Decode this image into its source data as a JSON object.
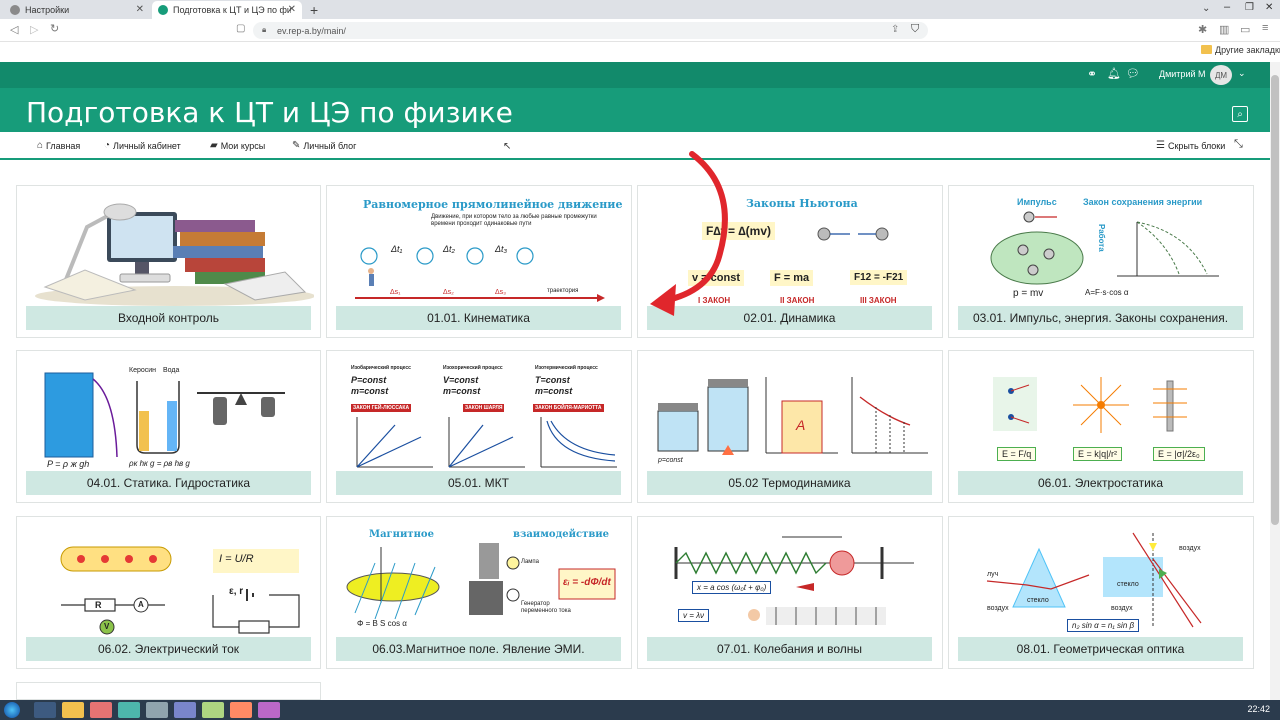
{
  "browser": {
    "tabs": [
      {
        "title": "Настройки",
        "active": false
      },
      {
        "title": "Подготовка к ЦТ и ЦЭ по физике",
        "active": true
      },
      {
        "title": "",
        "active": false
      }
    ],
    "new_tab_label": "+",
    "url": "ev.rep-a.by/main/",
    "bookmarks_folder": "Другие закладки"
  },
  "site": {
    "user_name": "Дмитрий М",
    "user_initials": "ДМ",
    "title": "Подготовка к ЦТ и ЦЭ по физике",
    "nav": [
      {
        "label": "Главная",
        "icon": "home-icon"
      },
      {
        "label": "Личный кабинет",
        "icon": "dashboard-icon"
      },
      {
        "label": "Мои курсы",
        "icon": "briefcase-icon"
      },
      {
        "label": "Личный блог",
        "icon": "wrench-icon"
      }
    ],
    "hide_blocks_label": "Скрыть блоки"
  },
  "courses": [
    {
      "label": "Входной контроль",
      "image": "desk"
    },
    {
      "label": "01.01. Кинематика",
      "image": "kinematics",
      "heading": "Равномерное прямолинейное движение",
      "text": "Движение, при котором тело за любые равные промежутки времени проходит одинаковые пути",
      "path_label": "траектория"
    },
    {
      "label": "02.01. Динамика",
      "image": "dynamics",
      "heading": "Законы Ньютона",
      "laws": [
        "I ЗАКОН",
        "II ЗАКОН",
        "III ЗАКОН"
      ],
      "formulas": [
        "F∆t = ∆(mv)",
        "v = const",
        "F = ma",
        "F12 = -F21"
      ]
    },
    {
      "label": "03.01. Импульс, энергия. Законы сохранения.",
      "image": "momentum",
      "heading_left": "Импульс",
      "heading_right": "Закон сохранения энергии",
      "side_label": "Работа",
      "formulas": [
        "p = mv",
        "A=F·s·cos α"
      ]
    },
    {
      "label": "04.01. Статика. Гидростатика",
      "image": "statics",
      "liquids": [
        "Керосин",
        "Вода"
      ],
      "formulas": [
        "P = ρ ж gh",
        "ρк hк g = ρв hв g"
      ]
    },
    {
      "label": "05.01. МКТ",
      "image": "mkt",
      "processes": [
        {
          "name": "Изобарический процесс",
          "lines": [
            "P=const",
            "m=const"
          ],
          "law": "ЗАКОН ГЕЙ-ЛЮССАКА"
        },
        {
          "name": "Изохорический процесс",
          "lines": [
            "V=const",
            "m=const"
          ],
          "law": "ЗАКОН ШАРЛЯ"
        },
        {
          "name": "Изотермический процесс",
          "lines": [
            "T=const",
            "m=const"
          ],
          "law": "ЗАКОН БОЙЛЯ-МАРИОТТА"
        }
      ]
    },
    {
      "label": "05.02 Термодинамика",
      "image": "thermo",
      "formulas": [
        "p=const",
        "A"
      ]
    },
    {
      "label": "06.01. Электростатика",
      "image": "electrostatics",
      "formulas": [
        "E = F/q",
        "E = k|q|/r²",
        "E = |σ|/2ε₀"
      ]
    },
    {
      "label": "06.02. Электрический ток",
      "image": "current",
      "formulas": [
        "I = U/R",
        "R",
        "ε, r",
        "A",
        "V"
      ]
    },
    {
      "label": "06.03.Магнитное поле. Явление ЭМИ.",
      "image": "magnetism",
      "heading_left": "Магнитное",
      "heading_right": "взаимодействие",
      "labels": [
        "Лампа",
        "Генератор переменного тока"
      ],
      "formulas": [
        "εᵢ = -dΦ/dt",
        "Φ = B S cos α"
      ]
    },
    {
      "label": "07.01. Колебания и волны",
      "image": "oscillations",
      "formulas": [
        "x = a cos (ω₀t + φ₀)",
        "v = λν"
      ]
    },
    {
      "label": "08.01. Геометрическая оптика",
      "image": "optics",
      "labels": [
        "луч",
        "воздух",
        "стекло",
        "воздух",
        "стекло",
        "воздух"
      ],
      "formulas": [
        "n₂ sin α = n₁ sin β"
      ]
    }
  ],
  "taskbar": {
    "clock": "22:42"
  },
  "colors": {
    "brand_dark": "#128a6b",
    "brand": "#179c7a",
    "label_bg": "#cfe8e2",
    "annotation_red": "#e0262c"
  }
}
